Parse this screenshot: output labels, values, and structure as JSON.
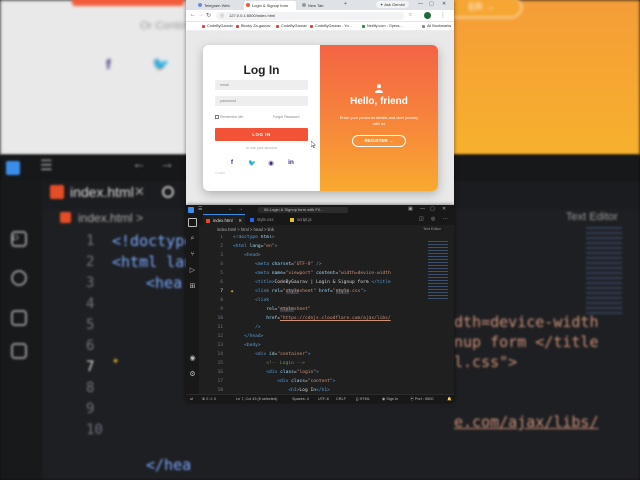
{
  "background": {
    "or_text": "Or Contin",
    "register_text": "ER →",
    "code_lines": [
      "<!doctype",
      "<html lan",
      "<hea",
      "",
      "",
      "",
      "",
      "",
      "",
      "",
      "</hea"
    ],
    "right_code": [
      "dth=device-width",
      "nup form </title",
      "l.css\">",
      "",
      "",
      "e.com/ajax/libs/"
    ],
    "text_editor": "Text Editor"
  },
  "browser": {
    "tabs": [
      {
        "label": "Telegram Web"
      },
      {
        "label": "Login & Signup form"
      },
      {
        "label": "New Tab"
      }
    ],
    "gemini_label": "Ask Gemini",
    "url": "127.0.0.1:5500/index.html",
    "bookmarks": [
      "CodeByGaurav",
      "Blocky Za-gaurav",
      "CodeByGaurav",
      "CodeByGaurav - Yo...",
      "Netlify.com - Opera...",
      "All Bookmarks"
    ],
    "login": {
      "title": "Log In",
      "email_placeholder": "email",
      "password_placeholder": "password",
      "remember": "Remember Me",
      "forgot": "Forgot Password",
      "button": "LOG IN",
      "or_social": "or use your account",
      "signature": "© 2024"
    },
    "panel": {
      "title": "Hello, friend",
      "subtitle": "Enter your personal details and start journey with us",
      "register": "REGISTER →"
    }
  },
  "editor": {
    "title": "06-Login & Signup form with Fli...",
    "tabs": [
      {
        "label": "index.html"
      },
      {
        "label": "style.css"
      },
      {
        "label": "script.js"
      }
    ],
    "breadcrumb": "index.html  >  html  >  head  >  link",
    "text_editor": "Text Editor",
    "line_numbers": [
      "1",
      "2",
      "3",
      "4",
      "5",
      "6",
      "7",
      "8",
      "9",
      "10",
      "11",
      "12",
      "13",
      "14",
      "15",
      "16",
      "17",
      "18"
    ],
    "status": {
      "errors": "⊗ 0  ⚠ 0",
      "cursor": "Ln 7, Col 43 (5 selected)",
      "spaces": "Spaces: 4",
      "encoding": "UTF-8",
      "eol": "CRLF",
      "language": "{} HTML",
      "signin": "Sign In",
      "port": "Port : 5500"
    }
  }
}
